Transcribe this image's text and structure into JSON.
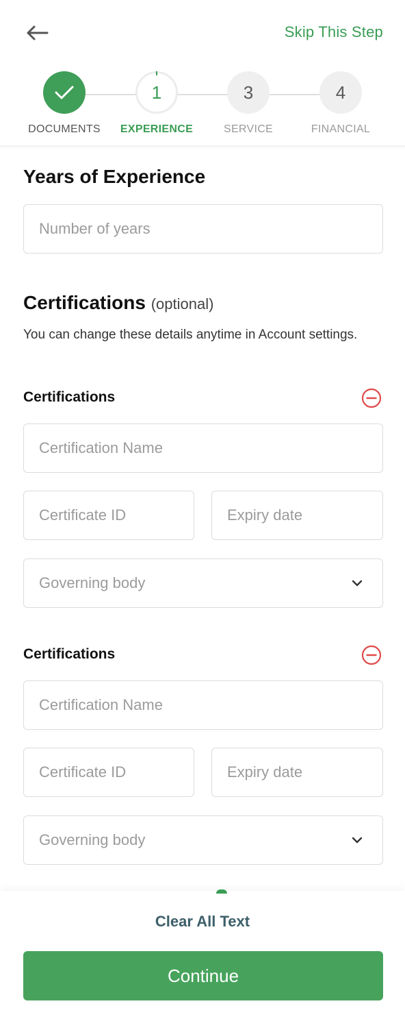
{
  "header": {
    "back_icon": "arrow-left-icon",
    "skip_label": "Skip This Step"
  },
  "stepper": {
    "steps": [
      {
        "number": "",
        "label": "DOCUMENTS",
        "status": "done"
      },
      {
        "number": "1",
        "label": "EXPERIENCE",
        "status": "active"
      },
      {
        "number": "3",
        "label": "SERVICE",
        "status": "todo"
      },
      {
        "number": "4",
        "label": "FINANCIAL",
        "status": "todo"
      }
    ]
  },
  "experience": {
    "title": "Years of Experience",
    "years_placeholder": "Number of years"
  },
  "certifications": {
    "title": "Certifications",
    "optional": "(optional)",
    "description": "You can change these details anytime in Account settings.",
    "blocks": [
      {
        "title": "Certifications",
        "name_placeholder": "Certification Name",
        "id_placeholder": "Certificate ID",
        "expiry_placeholder": "Expiry date",
        "body_placeholder": "Governing body"
      },
      {
        "title": "Certifications",
        "name_placeholder": "Certification Name",
        "id_placeholder": "Certificate ID",
        "expiry_placeholder": "Expiry date",
        "body_placeholder": "Governing body"
      }
    ]
  },
  "footer": {
    "clear_label": "Clear All Text",
    "continue_label": "Continue"
  },
  "colors": {
    "brand_green": "#3a9d55",
    "continue_green": "#47a35c",
    "remove_red": "#e04a4a",
    "clear_text": "#3d5f6a"
  }
}
